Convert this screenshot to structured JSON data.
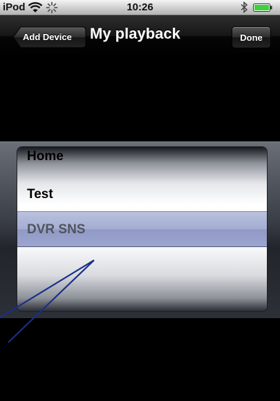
{
  "status_bar": {
    "carrier": "iPod",
    "time": "10:26",
    "icons": [
      "wifi-icon",
      "activity-spinner-icon",
      "bluetooth-icon",
      "battery-icon"
    ],
    "battery_color": "#3dd13d"
  },
  "nav_bar": {
    "back_label": "Add Device",
    "title": "My playback",
    "done_label": "Done"
  },
  "picker": {
    "rows": [
      "Home",
      "Test",
      "DVR SNS"
    ],
    "selected": "DVR SNS",
    "selection_tint": "#8f99c8"
  },
  "annotation": {
    "color": "#1a2f8a",
    "shape": "double-line pointer"
  }
}
